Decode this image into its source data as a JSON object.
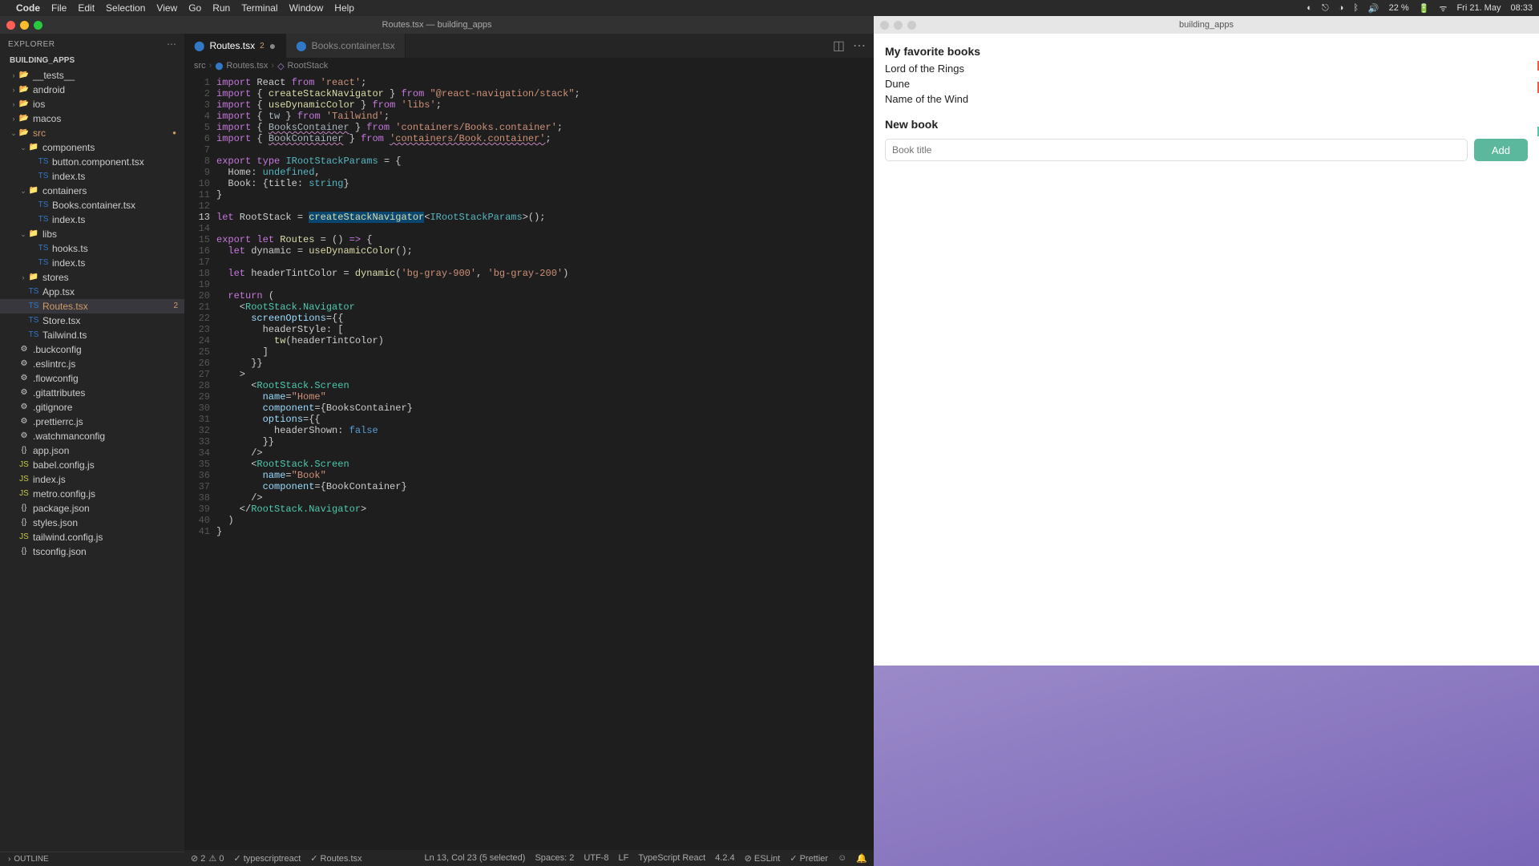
{
  "menubar": {
    "app": "Code",
    "items": [
      "File",
      "Edit",
      "Selection",
      "View",
      "Go",
      "Run",
      "Terminal",
      "Window",
      "Help"
    ],
    "right": {
      "battery": "22 %",
      "date": "Fri 21. May",
      "time": "08:33"
    }
  },
  "vscode": {
    "title": "Routes.tsx — building_apps",
    "sidebar": {
      "section": "EXPLORER",
      "project": "BUILDING_APPS",
      "tree": [
        {
          "i": 1,
          "chev": "›",
          "icon": "📂",
          "label": "__tests__"
        },
        {
          "i": 1,
          "chev": "›",
          "icon": "📂",
          "label": "android"
        },
        {
          "i": 1,
          "chev": "›",
          "icon": "📂",
          "label": "ios"
        },
        {
          "i": 1,
          "chev": "›",
          "icon": "📂",
          "label": "macos"
        },
        {
          "i": 1,
          "chev": "⌄",
          "icon": "📂",
          "label": "src",
          "mod": true
        },
        {
          "i": 2,
          "chev": "⌄",
          "icon": "📁",
          "label": "components"
        },
        {
          "i": 3,
          "chev": "",
          "icon": "TS",
          "label": "button.component.tsx"
        },
        {
          "i": 3,
          "chev": "",
          "icon": "TS",
          "label": "index.ts"
        },
        {
          "i": 2,
          "chev": "⌄",
          "icon": "📁",
          "label": "containers"
        },
        {
          "i": 3,
          "chev": "",
          "icon": "TS",
          "label": "Books.container.tsx"
        },
        {
          "i": 3,
          "chev": "",
          "icon": "TS",
          "label": "index.ts"
        },
        {
          "i": 2,
          "chev": "⌄",
          "icon": "📁",
          "label": "libs"
        },
        {
          "i": 3,
          "chev": "",
          "icon": "TS",
          "label": "hooks.ts"
        },
        {
          "i": 3,
          "chev": "",
          "icon": "TS",
          "label": "index.ts"
        },
        {
          "i": 2,
          "chev": "›",
          "icon": "📁",
          "label": "stores"
        },
        {
          "i": 2,
          "chev": "",
          "icon": "TS",
          "label": "App.tsx"
        },
        {
          "i": 2,
          "chev": "",
          "icon": "TS",
          "label": "Routes.tsx",
          "active": true,
          "badge": "2",
          "mod": true
        },
        {
          "i": 2,
          "chev": "",
          "icon": "TS",
          "label": "Store.tsx"
        },
        {
          "i": 2,
          "chev": "",
          "icon": "TS",
          "label": "Tailwind.ts"
        },
        {
          "i": 1,
          "chev": "",
          "icon": "⚙",
          "label": ".buckconfig"
        },
        {
          "i": 1,
          "chev": "",
          "icon": "⚙",
          "label": ".eslintrc.js"
        },
        {
          "i": 1,
          "chev": "",
          "icon": "⚙",
          "label": ".flowconfig"
        },
        {
          "i": 1,
          "chev": "",
          "icon": "⚙",
          "label": ".gitattributes"
        },
        {
          "i": 1,
          "chev": "",
          "icon": "⚙",
          "label": ".gitignore"
        },
        {
          "i": 1,
          "chev": "",
          "icon": "⚙",
          "label": ".prettierrc.js"
        },
        {
          "i": 1,
          "chev": "",
          "icon": "⚙",
          "label": ".watchmanconfig"
        },
        {
          "i": 1,
          "chev": "",
          "icon": "{}",
          "label": "app.json"
        },
        {
          "i": 1,
          "chev": "",
          "icon": "JS",
          "label": "babel.config.js"
        },
        {
          "i": 1,
          "chev": "",
          "icon": "JS",
          "label": "index.js"
        },
        {
          "i": 1,
          "chev": "",
          "icon": "JS",
          "label": "metro.config.js"
        },
        {
          "i": 1,
          "chev": "",
          "icon": "{}",
          "label": "package.json"
        },
        {
          "i": 1,
          "chev": "",
          "icon": "{}",
          "label": "styles.json"
        },
        {
          "i": 1,
          "chev": "",
          "icon": "JS",
          "label": "tailwind.config.js"
        },
        {
          "i": 1,
          "chev": "",
          "icon": "{}",
          "label": "tsconfig.json"
        }
      ],
      "outline": "OUTLINE"
    },
    "tabs": [
      {
        "label": "Routes.tsx",
        "badge": "2",
        "dirty": true,
        "active": true
      },
      {
        "label": "Books.container.tsx",
        "active": false
      }
    ],
    "breadcrumb": [
      "src",
      "Routes.tsx",
      "RootStack"
    ],
    "statusbar": {
      "errors": "2",
      "warnings": "0",
      "lang_mode": "typescriptreact",
      "file": "Routes.tsx",
      "pos": "Ln 13, Col 23 (5 selected)",
      "spaces": "Spaces: 2",
      "enc": "UTF-8",
      "eol": "LF",
      "lang": "TypeScript React",
      "ver": "4.2.4",
      "eslint": "ESLint",
      "prettier": "Prettier"
    }
  },
  "sim": {
    "title": "building_apps",
    "h1": "My favorite books",
    "books": [
      "Lord of the Rings",
      "Dune",
      "Name of the Wind"
    ],
    "h2": "New book",
    "placeholder": "Book title",
    "button": "Add"
  }
}
